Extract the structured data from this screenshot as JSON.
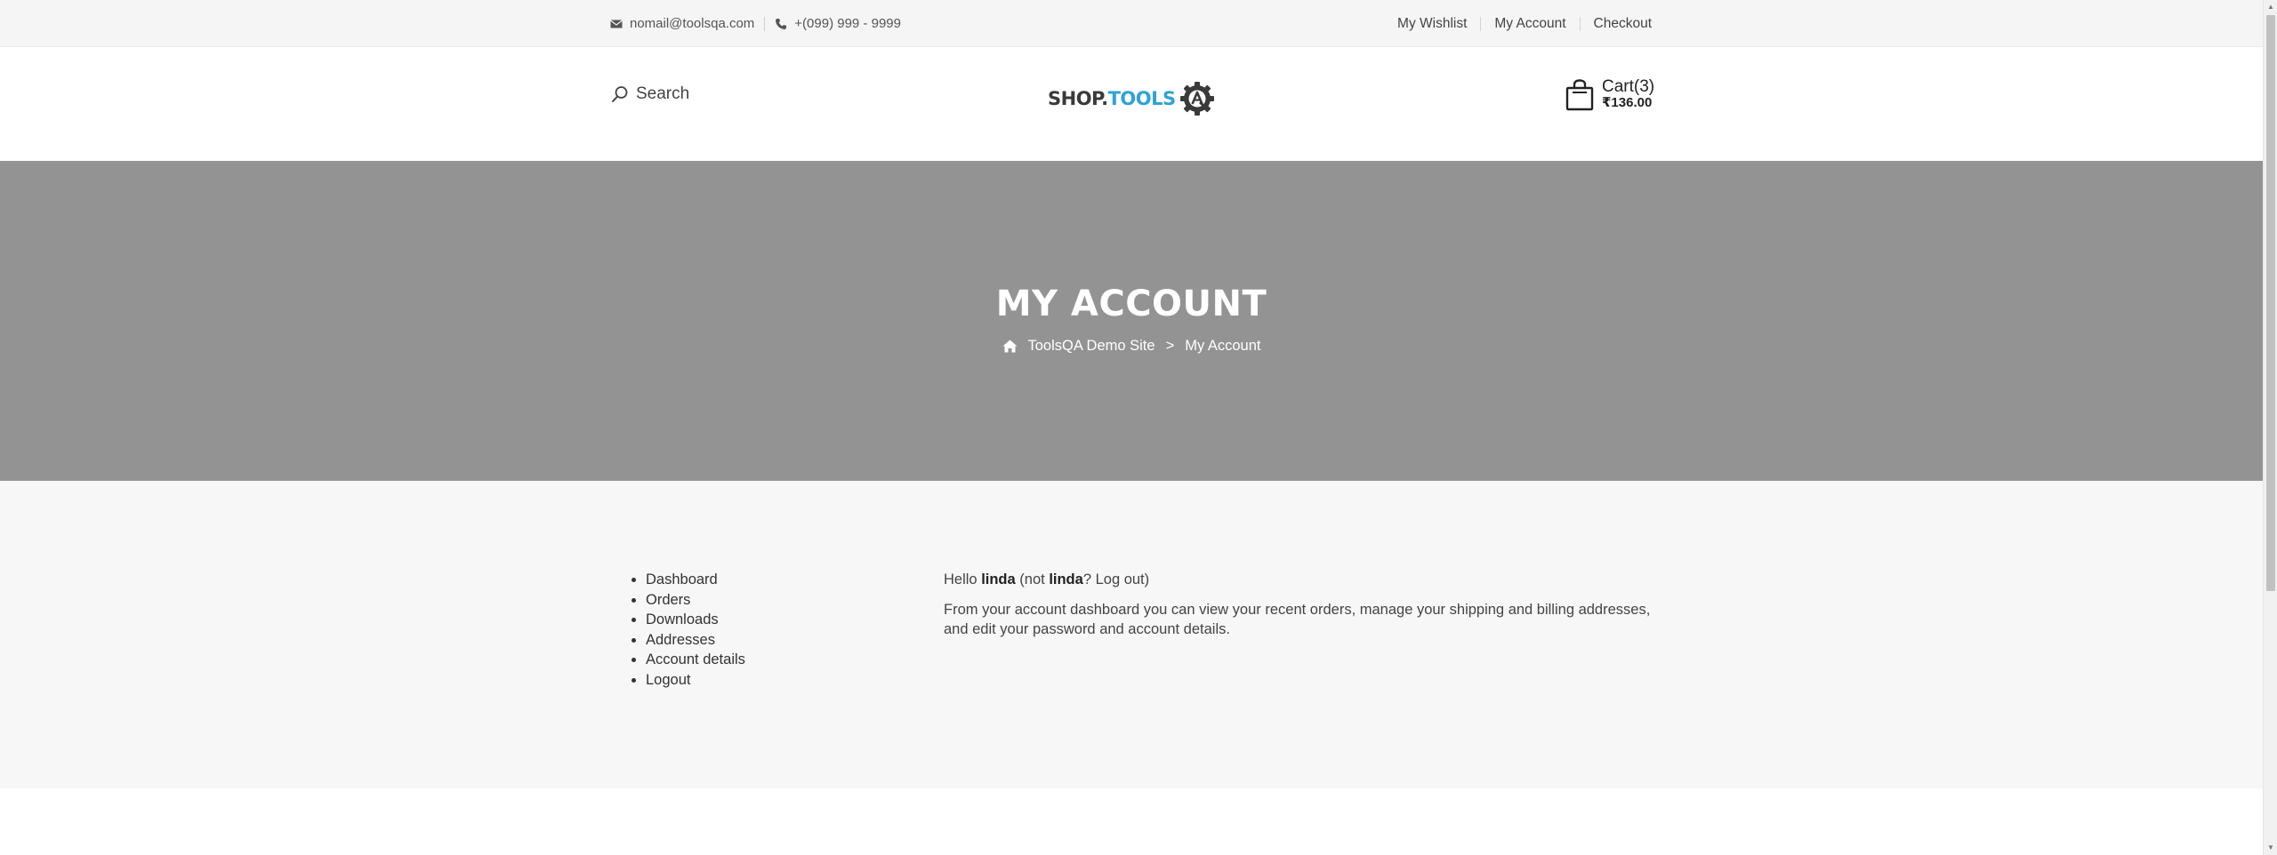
{
  "topbar": {
    "email": "nomail@toolsqa.com",
    "phone": "+(099) 999 - 9999",
    "links": [
      "My Wishlist",
      "My Account",
      "Checkout"
    ]
  },
  "header": {
    "search_label": "Search",
    "logo": {
      "shop": "SHOP.",
      "tools": "TOOLS"
    },
    "cart": {
      "label": "Cart(3)",
      "total": "₹136.00"
    }
  },
  "banner": {
    "title": "MY ACCOUNT",
    "breadcrumb": {
      "home": "ToolsQA Demo Site",
      "separator": ">",
      "current": "My Account"
    }
  },
  "account": {
    "nav": [
      "Dashboard",
      "Orders",
      "Downloads",
      "Addresses",
      "Account details",
      "Logout"
    ],
    "hello": {
      "prefix": "Hello ",
      "user": "linda",
      "middle": " (not ",
      "user2": "linda",
      "question": "? ",
      "logout": "Log out",
      "suffix": ")"
    },
    "dashboard_text": {
      "part1": "From your account dashboard you can view your ",
      "recent_orders": "recent orders",
      "part2": ", manage your ",
      "addresses": "shipping and billing addresses",
      "part3": ", and ",
      "account_details": "edit your password and account details",
      "part4": "."
    }
  },
  "colors": {
    "topbar_bg": "#f5f5f5",
    "banner_bg": "#939393",
    "account_bg": "#f7f7f7",
    "logo_accent": "#2fa3d6"
  }
}
